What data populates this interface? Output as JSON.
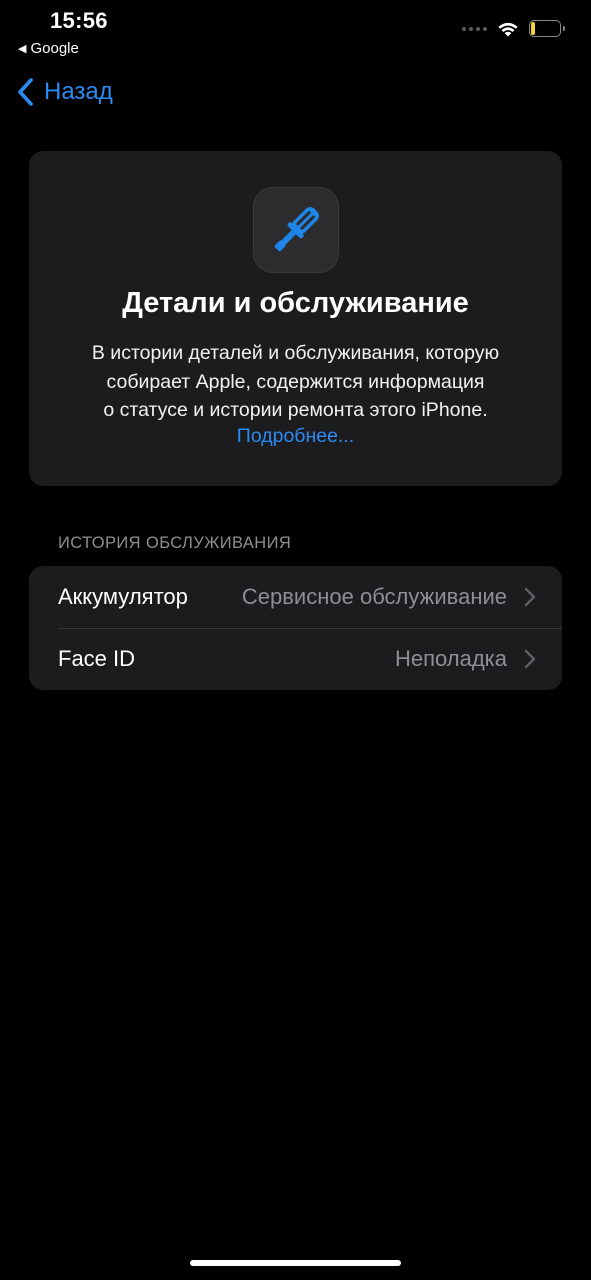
{
  "status_bar": {
    "time": "15:56",
    "back_app": "Google",
    "battery_level": "14",
    "battery_fill_fraction": 0.14,
    "battery_color": "#f3d23b",
    "icons": [
      "cellular-dots-icon",
      "wifi-icon",
      "battery-icon"
    ]
  },
  "nav": {
    "back_label": "Назад"
  },
  "info_card": {
    "icon": "screwdriver-icon",
    "title": "Детали и обслуживание",
    "desc_line1": "В истории деталей и обслуживания, которую",
    "desc_line2": "собирает Apple, содержится информация",
    "desc_line3": "о статусе и истории ремонта этого iPhone.",
    "link": "Подробнее..."
  },
  "service_history": {
    "header": "ИСТОРИЯ ОБСЛУЖИВАНИЯ",
    "rows": [
      {
        "label": "Аккумулятор",
        "value": "Сервисное обслуживание"
      },
      {
        "label": "Face ID",
        "value": "Неполадка"
      }
    ]
  },
  "colors": {
    "accent": "#2b8bf2",
    "background": "#000000",
    "card": "#1c1c1e",
    "secondary_text": "#8e8e93"
  }
}
